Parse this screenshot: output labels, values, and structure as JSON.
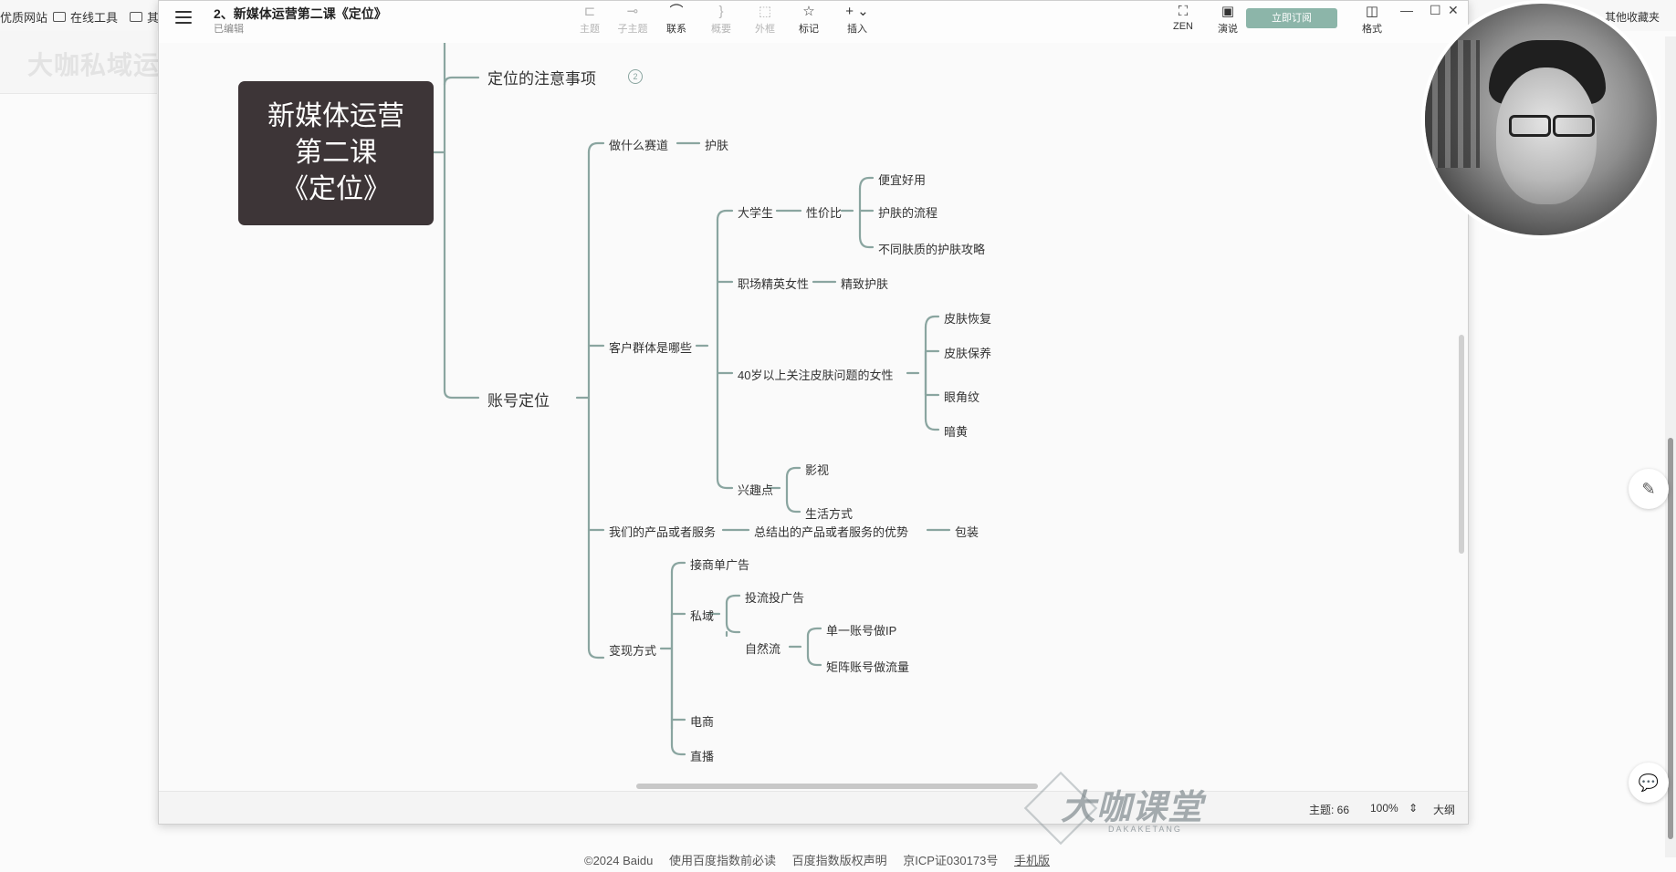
{
  "browser": {
    "bookmarks": [
      "优质网站",
      "在线工具",
      "其"
    ],
    "bookmark_right": "其他收藏夹",
    "faint_brand": "大咖私域运营  bilibili",
    "footer": [
      "©2024 Baidu",
      "使用百度指数前必读",
      "百度指数版权声明",
      "京ICP证030173号",
      "手机版"
    ]
  },
  "app": {
    "title": "2、新媒体运营第二课《定位》",
    "status": "已编辑",
    "toolbar": [
      {
        "icon": "topic-icon",
        "label": "主题",
        "enabled": false
      },
      {
        "icon": "subtopic-icon",
        "label": "子主题",
        "enabled": false
      },
      {
        "icon": "link-icon",
        "label": "联系",
        "enabled": true
      },
      {
        "icon": "summary-icon",
        "label": "概要",
        "enabled": false
      },
      {
        "icon": "boundary-icon",
        "label": "外框",
        "enabled": false
      },
      {
        "icon": "star-icon",
        "label": "标记",
        "enabled": true
      },
      {
        "icon": "plus-icon",
        "label": "插入",
        "enabled": true
      }
    ],
    "toolbar_right": [
      {
        "icon": "zen-icon",
        "label": "ZEN"
      },
      {
        "icon": "present-icon",
        "label": "演说"
      },
      {
        "icon": "format-icon",
        "label": "格式"
      }
    ],
    "upgrade_label": "立即订阅"
  },
  "mindmap": {
    "root": [
      "新媒体运营",
      "第二课",
      "《定位》"
    ],
    "branch_notes": "定位的注意事项",
    "branch_notes_badge": "2",
    "branch_account": "账号定位",
    "track": "做什么赛道",
    "track_skin": "护肤",
    "audience": "客户群体是哪些",
    "students": "大学生",
    "value": "性价比",
    "cheap": "便宜好用",
    "flow": "护肤的流程",
    "guide": "不同肤质的护肤攻略",
    "office": "职场精英女性",
    "refined": "精致护肤",
    "over40": "40岁以上关注皮肤问题的女性",
    "recover": "皮肤恢复",
    "maintain": "皮肤保养",
    "wrinkle": "眼角纹",
    "dull": "暗黄",
    "interest": "兴趣点",
    "film": "影视",
    "lifestyle": "生活方式",
    "product": "我们的产品或者服务",
    "advantage": "总结出的产品或者服务的优势",
    "packaging": "包装",
    "monetize": "变现方式",
    "ads": "接商单广告",
    "private": "私域",
    "paid": "投流投广告",
    "natural": "自然流",
    "single_ip": "单一账号做IP",
    "matrix": "矩阵账号做流量",
    "ecommerce": "电商",
    "live": "直播"
  },
  "statusbar": {
    "topics": "主题: 66",
    "zoom": "100%",
    "outline": "大纲"
  },
  "watermark": {
    "text": "大咖课堂",
    "sub": "DAKAKETANG"
  },
  "colors": {
    "root_bg": "#3d3537",
    "line": "#8aa5a0",
    "upgrade": "#8cb5a9"
  }
}
